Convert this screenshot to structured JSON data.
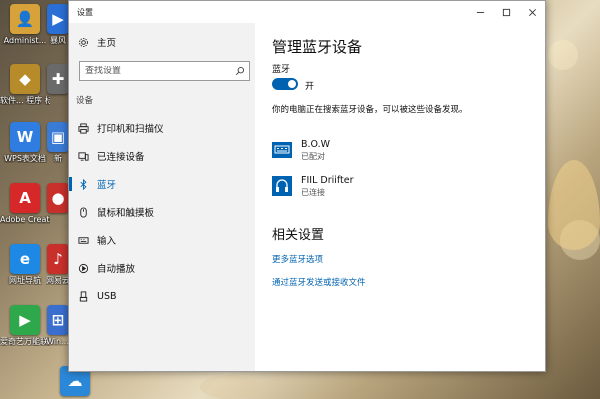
{
  "desktop": {
    "icons": [
      {
        "label": "Administ...",
        "icon": "user-folder-icon",
        "color": "#d8a23a"
      },
      {
        "label": "暴风",
        "icon": "app-icon",
        "color": "#2a6fd6"
      },
      {
        "label": "软件... 程序 标准版",
        "icon": "app-icon",
        "color": "#b88b2a"
      },
      {
        "label": "",
        "icon": "gamepad-icon",
        "color": "#6a6a6a"
      },
      {
        "label": "WPS表文档",
        "icon": "wps-icon",
        "color": "#2f7de0"
      },
      {
        "label": "新",
        "icon": "app-icon",
        "color": "#3a7bd5"
      },
      {
        "label": "Adobe Creati...",
        "icon": "adobe-icon",
        "color": "#d62828"
      },
      {
        "label": "",
        "icon": "app-icon",
        "color": "#c8302c"
      },
      {
        "label": "网址导航",
        "icon": "ie-icon",
        "color": "#1e88e5"
      },
      {
        "label": "网易云音乐",
        "icon": "app-icon",
        "color": "#c9302c"
      },
      {
        "label": "爱奇艺万能联播",
        "icon": "app-icon",
        "color": "#2ea84b"
      },
      {
        "label": "Win... Work...",
        "icon": "app-icon",
        "color": "#3a6fcf"
      },
      {
        "label": "",
        "icon": "cloud-icon",
        "color": "#2b88d8"
      }
    ]
  },
  "window": {
    "title": "设置",
    "accent": "#0063b1"
  },
  "sidebar": {
    "home": "主页",
    "search_placeholder": "查找设置",
    "section": "设备",
    "items": [
      {
        "label": "打印机和扫描仪",
        "icon": "printer-icon"
      },
      {
        "label": "已连接设备",
        "icon": "connected-devices-icon"
      },
      {
        "label": "蓝牙",
        "icon": "bluetooth-icon",
        "active": true
      },
      {
        "label": "鼠标和触摸板",
        "icon": "mouse-icon"
      },
      {
        "label": "输入",
        "icon": "keyboard-icon"
      },
      {
        "label": "自动播放",
        "icon": "autoplay-icon"
      },
      {
        "label": "USB",
        "icon": "usb-icon"
      }
    ]
  },
  "main": {
    "title": "管理蓝牙设备",
    "bluetooth_label": "蓝牙",
    "toggle_state": "开",
    "toggle_on": true,
    "description": "你的电脑正在搜索蓝牙设备，可以被这些设备发现。",
    "devices": [
      {
        "name": "B.O.W",
        "status": "已配对",
        "icon": "keyboard-device-icon"
      },
      {
        "name": "FIIL Driifter",
        "status": "已连接",
        "icon": "headphones-icon"
      }
    ],
    "related_title": "相关设置",
    "links": [
      "更多蓝牙选项",
      "通过蓝牙发送或接收文件"
    ]
  }
}
